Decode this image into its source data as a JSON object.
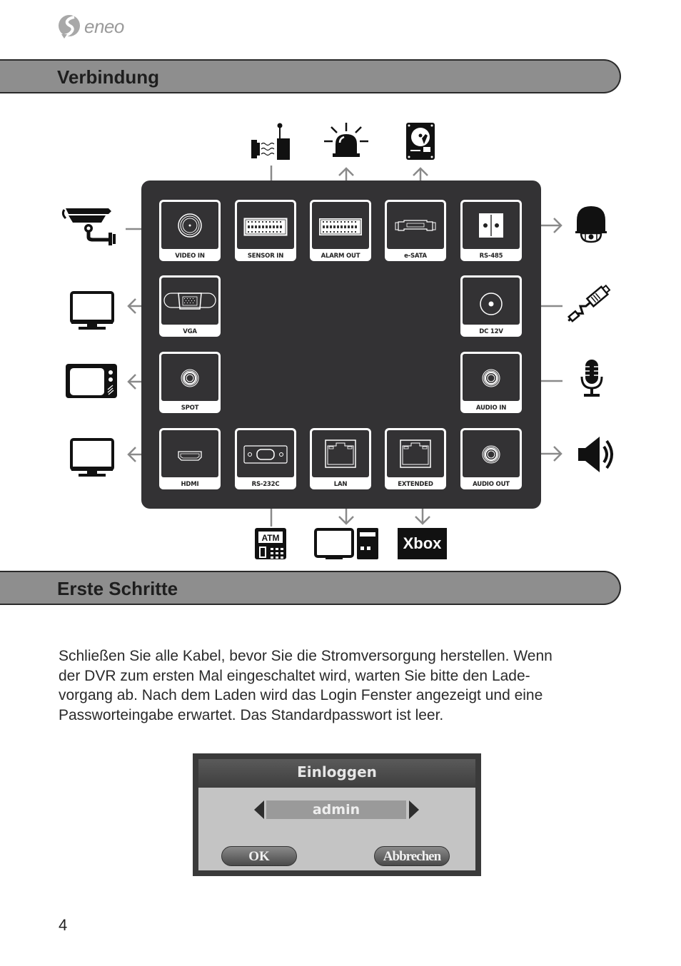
{
  "header": {
    "logo_text": "eneo",
    "logo_mark": "®"
  },
  "sections": [
    {
      "title": "Verbindung"
    },
    {
      "title": "Erste Schritte"
    }
  ],
  "ports": [
    {
      "id": "video-in",
      "label": "VIDEO IN"
    },
    {
      "id": "sensor-in",
      "label": "SENSOR IN"
    },
    {
      "id": "alarm-out",
      "label": "ALARM OUT"
    },
    {
      "id": "e-sata",
      "label": "e-SATA"
    },
    {
      "id": "rs-485",
      "label": "RS-485"
    },
    {
      "id": "vga",
      "label": "VGA"
    },
    {
      "id": "dc-12v",
      "label": "DC 12V"
    },
    {
      "id": "spot",
      "label": "SPOT"
    },
    {
      "id": "audio-in",
      "label": "AUDIO IN"
    },
    {
      "id": "hdmi",
      "label": "HDMI"
    },
    {
      "id": "rs-232c",
      "label": "RS-232C"
    },
    {
      "id": "lan",
      "label": "LAN"
    },
    {
      "id": "extended",
      "label": "EXTENDED"
    },
    {
      "id": "audio-out",
      "label": "AUDIO OUT"
    }
  ],
  "devices": {
    "atm_label": "ATM",
    "xbox_label": "Xbox"
  },
  "body": {
    "lines": [
      "Schließen Sie alle Kabel, bevor Sie die Stromversorgung herstellen. Wenn",
      "der DVR zum ersten Mal eingeschaltet wird, warten Sie bitte den Lade-",
      "vorgang ab. Nach dem Laden wird das Login Fenster angezeigt und eine",
      "Passworteingabe erwartet. Das Standardpasswort ist leer."
    ]
  },
  "login_dialog": {
    "title": "Einloggen",
    "user_value": "admin",
    "ok_label": "OK",
    "cancel_label": "Abbrechen"
  },
  "footer": {
    "page_number": "4"
  }
}
